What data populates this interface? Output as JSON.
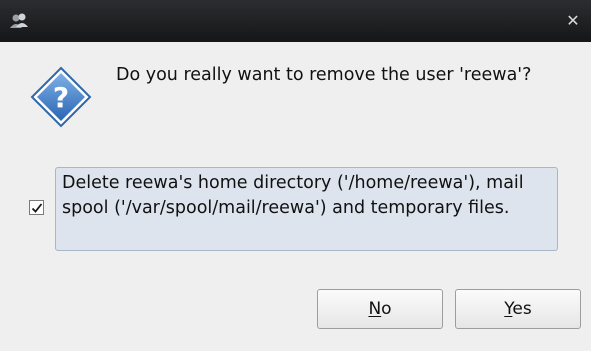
{
  "dialog": {
    "question": "Do you really want to remove the user 'reewa'?",
    "option": {
      "checked": true,
      "label": "Delete reewa's home directory ('/home/reewa'), mail spool ('/var/spool/mail/reewa') and temporary files."
    },
    "buttons": {
      "no": {
        "mnemonic": "N",
        "rest": "o"
      },
      "yes": {
        "mnemonic": "Y",
        "rest": "es"
      }
    }
  },
  "icons": {
    "titlebar": "users-icon",
    "close": "close-icon",
    "question": "question-diamond-icon"
  },
  "colors": {
    "titlebar": "#1f2023",
    "option_bg": "#dde4ee",
    "icon_blue": "#3a78c0"
  }
}
